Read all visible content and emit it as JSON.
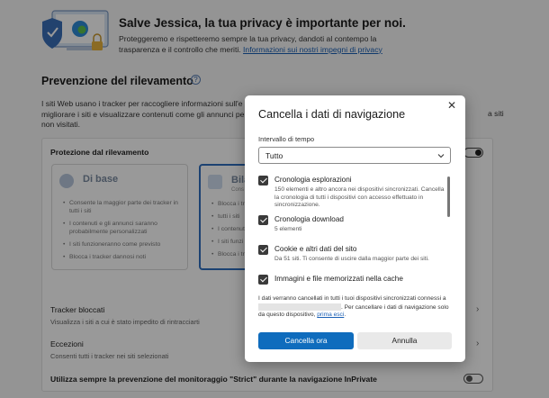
{
  "page": {
    "hero_title": "Salve Jessica, la tua privacy è importante per noi.",
    "hero_desc": "Proteggeremo e rispetteremo sempre la tua privacy, dandoti al contempo la trasparenza e il controllo che meriti.",
    "hero_link": "Informazioni sui nostri impegni di privacy",
    "section_title": "Prevenzione del rilevamento",
    "section_help": "?",
    "section_desc_1": "I siti Web usano i tracker per raccogliere informazioni sull'e",
    "section_desc_2": "migliorare i siti e visualizzare contenuti come gli annunci per",
    "section_desc_3": "non visitati.",
    "section_desc_right": "a siti",
    "card_title": "Protezione dal rilevamento",
    "basic": {
      "name": "Di base",
      "bullets": [
        "Consente la maggior parte dei tracker in tutti i siti",
        "I contenuti e gli annunci saranno probabilmente personalizzati",
        "I siti funzioneranno come previsto",
        "Blocca i tracker dannosi noti"
      ]
    },
    "balanced": {
      "name": "Bila",
      "sub": "Cons",
      "bullets": [
        "Blocca i tr",
        "tutti i siti",
        "I contenuti",
        "I siti funzi",
        "Blocca i tr"
      ]
    },
    "rows": {
      "blocked_title": "Tracker bloccati",
      "blocked_sub": "Visualizza i siti a cui è stato impedito di rintracciarti",
      "exceptions_title": "Eccezioni",
      "exceptions_sub": "Consenti tutti i tracker nei siti selezionati",
      "strict_title": "Utilizza sempre la prevenzione del monitoraggio \"Strict\" durante la navigazione InPrivate"
    },
    "chevron": "›"
  },
  "dialog": {
    "title": "Cancella i dati di navigazione",
    "close": "✕",
    "range_label": "Intervallo di tempo",
    "range_value": "Tutto",
    "items": [
      {
        "title": "Cronologia esplorazioni",
        "sub": "150 elementi e altro ancora nei dispositivi sincronizzati. Cancella la cronologia di tutti i dispositivi con accesso effettuato in sincronizzazione."
      },
      {
        "title": "Cronologia download",
        "sub": "5 elementi"
      },
      {
        "title": "Cookie e altri dati del sito",
        "sub": "Da 51 siti. Ti consente di uscire dalla maggior parte dei siti."
      },
      {
        "title": "Immagini e file memorizzati nella cache",
        "sub": ""
      }
    ],
    "note_1": "I dati verranno cancellati in tutti i tuoi dispositivi sincronizzati connessi a",
    "note_2": ". Per cancellare i dati di navigazione solo da questo dispositivo,",
    "note_link": "prima esci",
    "note_end": ".",
    "primary_button": "Cancella ora",
    "secondary_button": "Annulla"
  },
  "colors": {
    "accent": "#0f6cbd",
    "link": "#1a5fb4",
    "overlay": "rgba(0,0,0,0.40)"
  },
  "icons": [
    "privacy-illustration-icon",
    "help-icon",
    "chevron-right-icon",
    "close-icon",
    "chevron-down-icon",
    "checkbox-checked-icon"
  ]
}
